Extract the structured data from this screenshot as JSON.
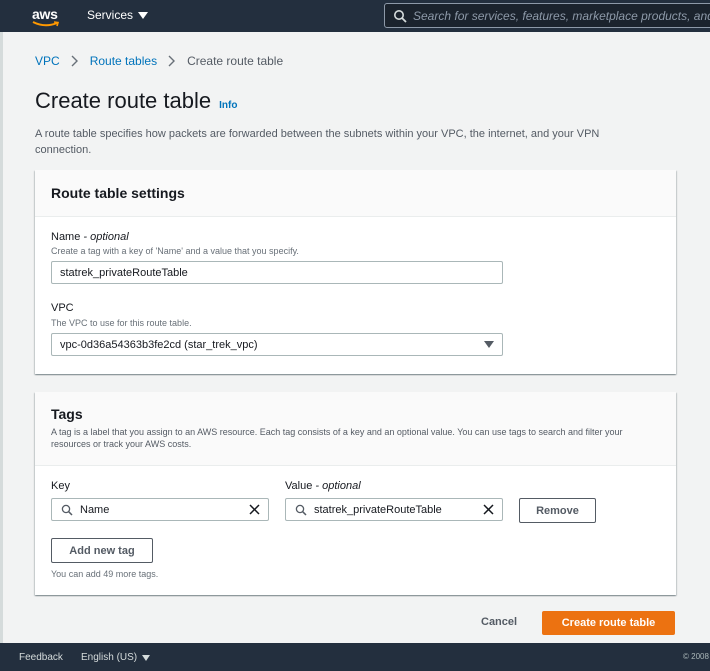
{
  "nav": {
    "logo": "aws",
    "services": "Services",
    "search_placeholder": "Search for services, features, marketplace products, and docs"
  },
  "breadcrumb": {
    "items": [
      "VPC",
      "Route tables"
    ],
    "current": "Create route table"
  },
  "page": {
    "title": "Create route table",
    "info": "Info",
    "description": "A route table specifies how packets are forwarded between the subnets within your VPC, the internet, and your VPN connection."
  },
  "settings": {
    "title": "Route table settings",
    "name_label": "Name",
    "name_optional": "- optional",
    "name_help": "Create a tag with a key of 'Name' and a value that you specify.",
    "name_value": "statrek_privateRouteTable",
    "vpc_label": "VPC",
    "vpc_help": "The VPC to use for this route table.",
    "vpc_value": "vpc-0d36a54363b3fe2cd (star_trek_vpc)"
  },
  "tags": {
    "title": "Tags",
    "description": "A tag is a label that you assign to an AWS resource. Each tag consists of a key and an optional value. You can use tags to search and filter your resources or track your AWS costs.",
    "key_label": "Key",
    "value_label": "Value",
    "value_optional": "- optional",
    "key_value": "Name",
    "value_value": "statrek_privateRouteTable",
    "remove": "Remove",
    "add_new": "Add new tag",
    "remaining": "You can add 49 more tags."
  },
  "actions": {
    "cancel": "Cancel",
    "create": "Create route table"
  },
  "footer": {
    "feedback": "Feedback",
    "language": "English (US)",
    "copyright": "© 2008"
  },
  "colors": {
    "nav_bg": "#232f3e",
    "link": "#0073bb",
    "primary": "#ec7211",
    "page_bg": "#f2f3f3"
  }
}
